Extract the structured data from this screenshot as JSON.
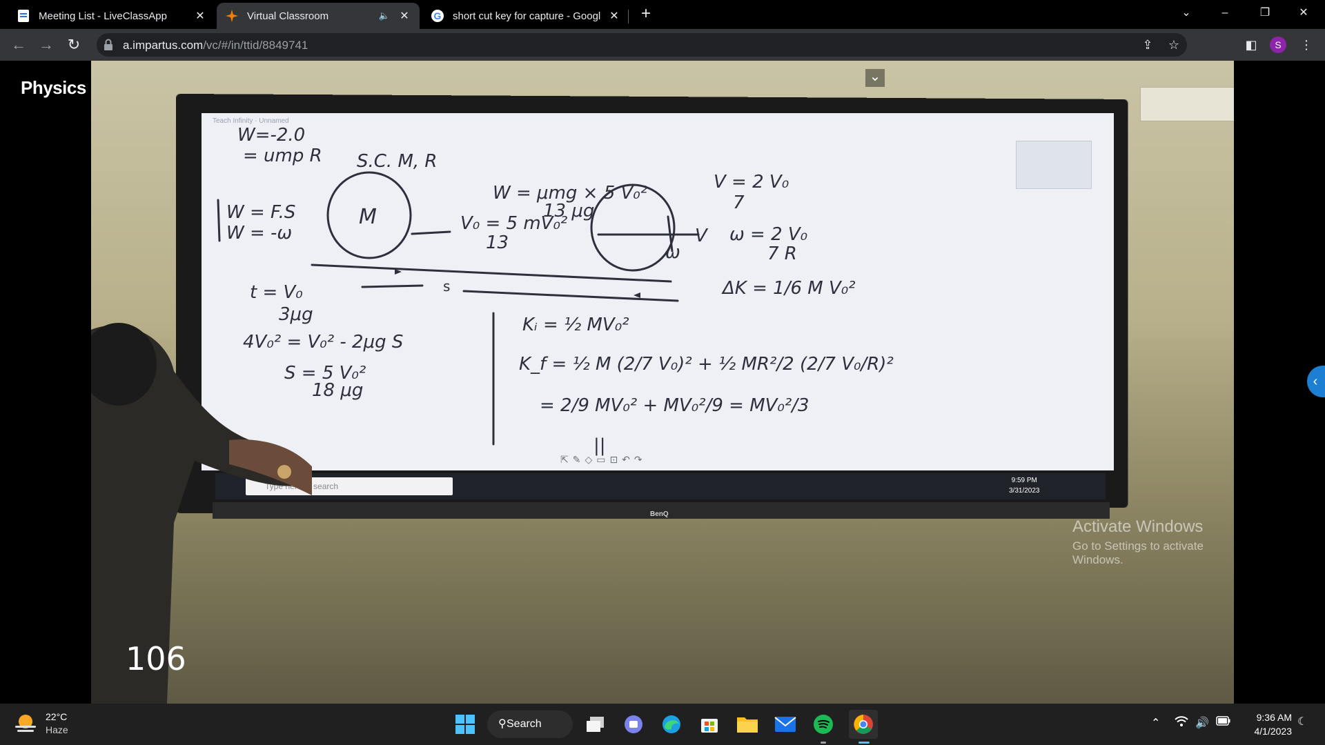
{
  "tabs": [
    {
      "title": "Meeting List - LiveClassApp",
      "active": false
    },
    {
      "title": "Virtual Classroom",
      "active": true,
      "audio": true
    },
    {
      "title": "short cut key for capture - Googl",
      "active": false
    }
  ],
  "address": {
    "host": "a.impartus.com",
    "path": "/vc/#/in/ttid/8849741"
  },
  "profile_initial": "S",
  "page": {
    "subject": "Physics",
    "video_counter": "106",
    "board": {
      "taskbar_search": "Type here to search",
      "time": "9:59 PM",
      "date": "3/31/2023",
      "brand": "BenQ"
    }
  },
  "activate_windows": {
    "title": "Activate Windows",
    "subtitle": "Go to Settings to activate Windows."
  },
  "taskbar": {
    "weather": {
      "temp": "22°C",
      "condition": "Haze"
    },
    "search_label": "Search",
    "time": "9:36 AM",
    "date": "4/1/2023"
  }
}
